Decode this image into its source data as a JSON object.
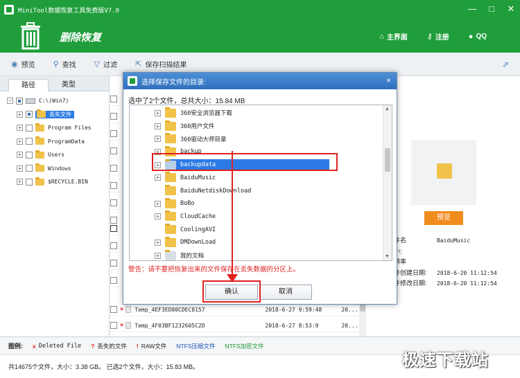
{
  "window": {
    "title": "MiniTool数据恢复工具免费版V7.0",
    "controls": [
      "—",
      "□",
      "✕"
    ]
  },
  "header": {
    "title": "删除恢复",
    "nav": [
      {
        "label": "主界面",
        "icon": "home-icon"
      },
      {
        "label": "注册",
        "icon": "key-icon"
      },
      {
        "label": "QQ",
        "icon": "qq-icon"
      }
    ]
  },
  "toolbar": {
    "items": [
      {
        "label": "预览",
        "icon": "eye-icon"
      },
      {
        "label": "查找",
        "icon": "search-icon"
      },
      {
        "label": "过滤",
        "icon": "filter-icon"
      },
      {
        "label": "保存扫描结果",
        "icon": "save-scan-icon"
      }
    ]
  },
  "left_panel": {
    "tabs": [
      "路径",
      "类型"
    ],
    "tree": [
      {
        "label": "C:\\(Win7)"
      },
      {
        "label": "丢失文件"
      },
      {
        "label": "Program Files"
      },
      {
        "label": "ProgramData"
      },
      {
        "label": "Users"
      },
      {
        "label": "Windows"
      },
      {
        "label": "$RECYCLE.BIN"
      }
    ]
  },
  "file_list": {
    "rows": [
      {
        "name": "Temp_4EF3ED80CDEC8157",
        "date": "2018-6-27 9:59:48",
        "size": "20..."
      },
      {
        "name": "Temp_4F03BF1232605C2D",
        "date": "2018-6-27 8:53:9",
        "size": "20..."
      }
    ]
  },
  "right_panel": {
    "preview_button": "预览",
    "info": [
      {
        "key": "件名",
        "value": "BaiduMusic"
      },
      {
        "key": "小:",
        "value": ""
      },
      {
        "key": "辨率",
        "value": ""
      },
      {
        "key": "件创建日期:",
        "value": "2018-6-20 11:12:54"
      },
      {
        "key": "件修改日期:",
        "value": "2018-6-20 11:12:54"
      }
    ]
  },
  "legend": {
    "label": "图例:",
    "items": [
      {
        "mark": "x",
        "text": "Deleted File"
      },
      {
        "mark": "?",
        "text": "丢失的文件"
      },
      {
        "mark": "!",
        "text": "RAW文件"
      },
      {
        "mark": "",
        "text": "NTFS压缩文件"
      },
      {
        "mark": "",
        "text": "NTFS加密文件"
      }
    ]
  },
  "status": {
    "text": "共14675个文件，大小：3.38 GB。 已选2个文件，大小：15.83 MB。"
  },
  "watermark": "极速下载站",
  "dialog": {
    "title": "选择保存文件的目录:",
    "close": "×",
    "summary": "选中了2个文件，总共大小：15.84 MB",
    "folders": [
      "360安全浏览器下载",
      "360用户文件",
      "360驱动大师目录",
      "backup",
      "backupdata",
      "BaiduMusic",
      "BaiduNetdiskDownload",
      "BoBo",
      "CloudCache",
      "CoolingAVI",
      "DMDownLoad",
      "我的文档"
    ],
    "selected_folder": "backupdata",
    "warning": "警告：请不要把恢复出来的文件保存在丢失数据的分区上。",
    "ok_label": "确认",
    "cancel_label": "取消"
  }
}
